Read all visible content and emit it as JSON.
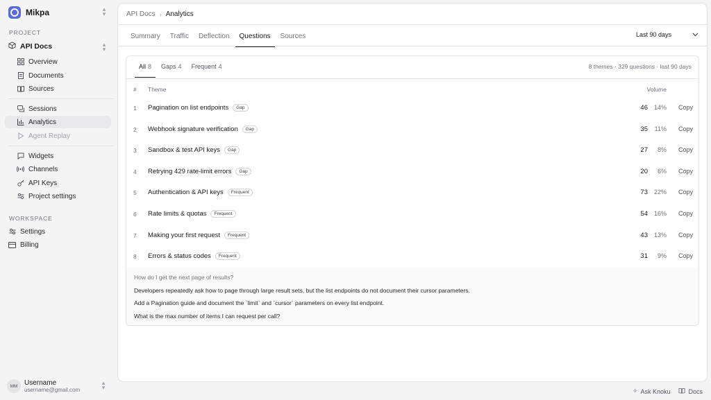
{
  "sidebar": {
    "org_name": "Mikpa",
    "project_label": "PROJECT",
    "project_name": "API Docs",
    "items": [
      {
        "label": "Overview"
      },
      {
        "label": "Documents"
      },
      {
        "label": "Sources"
      },
      {
        "label": "Sessions"
      },
      {
        "label": "Analytics"
      },
      {
        "label": "Agent Replay"
      },
      {
        "label": "Widgets"
      },
      {
        "label": "Channels"
      },
      {
        "label": "API Keys"
      },
      {
        "label": "Project settings"
      }
    ],
    "workspace_label": "WORKSPACE",
    "workspace_items": [
      {
        "label": "Settings"
      },
      {
        "label": "Billing"
      }
    ],
    "user": {
      "initials": "MM",
      "name": "Username",
      "email": "username@gmail.com"
    }
  },
  "breadcrumb": {
    "parent": "API Docs",
    "current": "Analytics"
  },
  "tabs": [
    {
      "label": "Summary"
    },
    {
      "label": "Traffic"
    },
    {
      "label": "Deflection"
    },
    {
      "label": "Questions"
    },
    {
      "label": "Sources"
    }
  ],
  "range": {
    "label": "Last 90 days"
  },
  "subtabs": [
    {
      "label": "All",
      "count": "8"
    },
    {
      "label": "Gaps",
      "count": "4"
    },
    {
      "label": "Frequent",
      "count": "4"
    }
  ],
  "summary": "8 themes · 329 questions · last 90 days",
  "table": {
    "headers": {
      "num": "#",
      "theme": "Theme",
      "volume": "Volume"
    },
    "rows": [
      {
        "num": "1",
        "theme": "Pagination on list endpoints",
        "badge": "Gap",
        "count": "46",
        "pct": "14%",
        "action": "Copy"
      },
      {
        "num": "2",
        "theme": "Webhook signature verification",
        "badge": "Gap",
        "count": "35",
        "pct": "11%",
        "action": "Copy"
      },
      {
        "num": "3",
        "theme": "Sandbox & test API keys",
        "badge": "Gap",
        "count": "27",
        "pct": "8%",
        "action": "Copy"
      },
      {
        "num": "4",
        "theme": "Retrying 429 rate-limit errors",
        "badge": "Gap",
        "count": "20",
        "pct": "6%",
        "action": "Copy"
      },
      {
        "num": "5",
        "theme": "Authentication & API keys",
        "badge": "Frequent",
        "count": "73",
        "pct": "22%",
        "action": "Copy"
      },
      {
        "num": "6",
        "theme": "Rate limits & quotas",
        "badge": "Frequent",
        "count": "54",
        "pct": "16%",
        "action": "Copy"
      },
      {
        "num": "7",
        "theme": "Making your first request",
        "badge": "Frequent",
        "count": "43",
        "pct": "13%",
        "action": "Copy"
      },
      {
        "num": "8",
        "theme": "Errors & status codes",
        "badge": "Frequent",
        "count": "31",
        "pct": "9%",
        "action": "Copy"
      }
    ]
  },
  "detail": {
    "question": "How do I get the next page of results?",
    "insight": "Developers repeatedly ask how to page through large result sets, but the list endpoints do not document their cursor parameters.",
    "recommendation": "Add a Pagination guide and document the `limit` and `cursor` parameters on every list endpoint.",
    "followup": "What is the max number of items I can request per call?"
  },
  "footer": {
    "ask": "Ask Knoku",
    "docs": "Docs"
  },
  "colors": {
    "brand": "#5b6bd6",
    "active_nav": "#e9e9eb",
    "border": "#e4e4e7"
  }
}
